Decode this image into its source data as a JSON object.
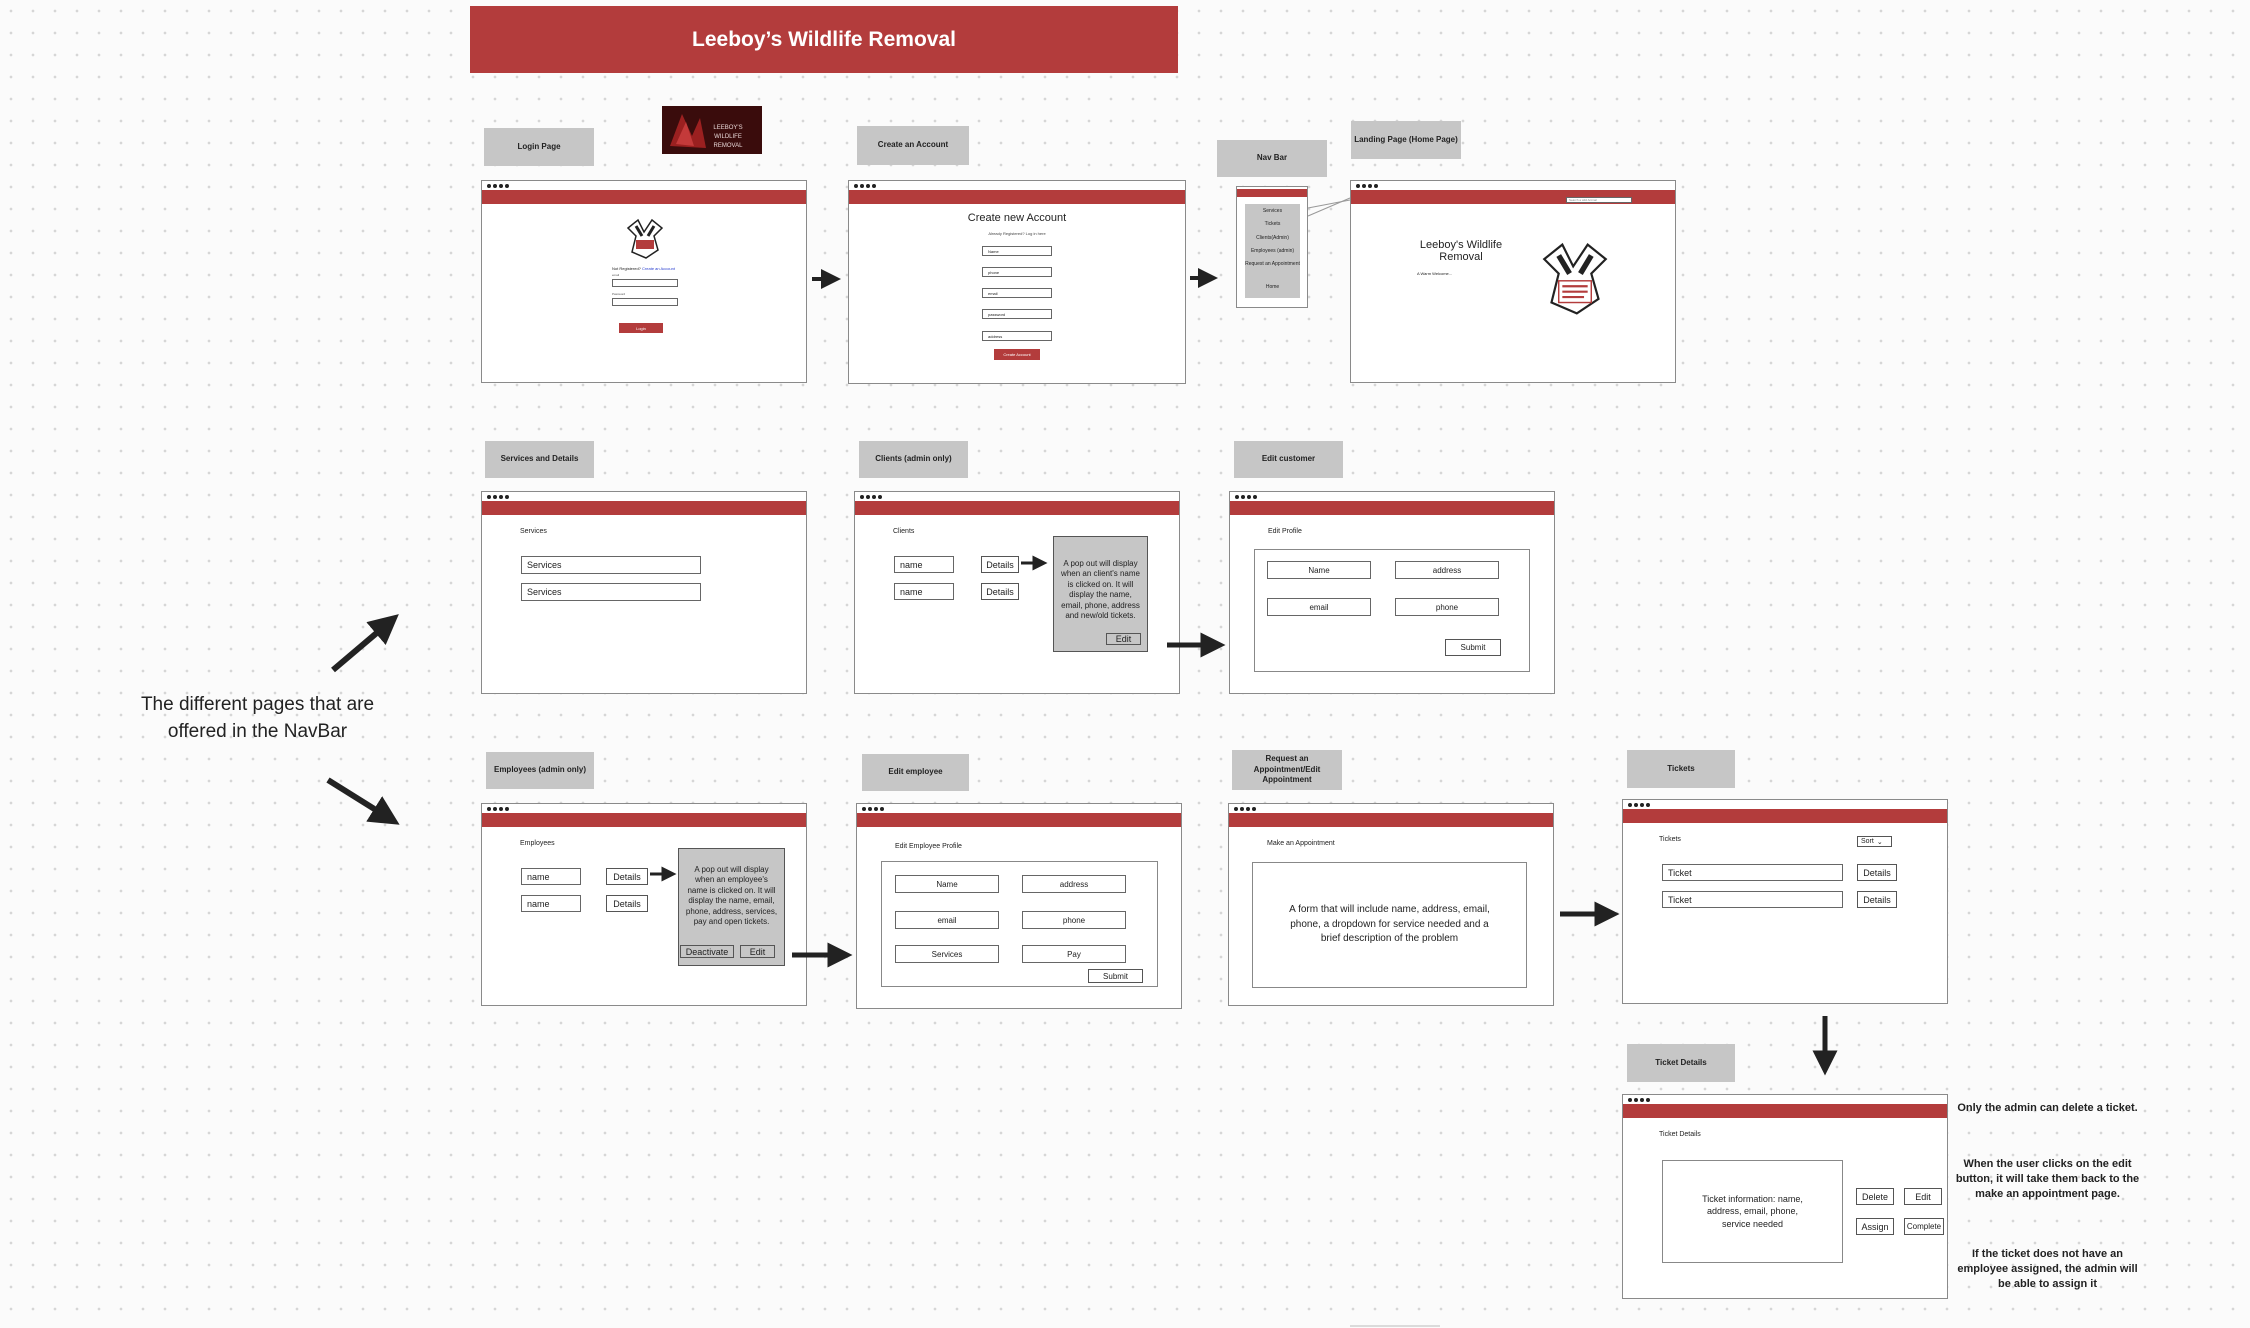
{
  "title": "Leeboy’s Wildlife Removal",
  "side_note": "The different pages that are offered in the NavBar",
  "logo_text": "LEEBOY'S WILDLIFE REMOVAL",
  "labels": {
    "login": "Login Page",
    "create": "Create an Account",
    "navbar": "Nav Bar",
    "landing": "Landing Page (Home Page)",
    "services": "Services and Details",
    "clients": "Clients (admin only)",
    "edit_customer": "Edit customer",
    "employees": "Employees (admin only)",
    "edit_employee": "Edit employee",
    "request": "Request an Appointment/Edit Appointment",
    "tickets": "Tickets",
    "ticket_details": "Ticket Details"
  },
  "login": {
    "not_registered": "Not Registered?",
    "create_link": "Create an Account",
    "email_label": "email",
    "password_label": "Password",
    "button": "Login"
  },
  "create": {
    "heading": "Create new Account",
    "subtext": "Already Registered? Log in here",
    "fields": [
      "Name",
      "phone",
      "email",
      "password",
      "address"
    ],
    "button": "Create Account"
  },
  "navbar": {
    "items": [
      "Services",
      "Tickets",
      "Clients(Admin)",
      "Employees (admin)",
      "Request an Appointment",
      "Home"
    ]
  },
  "landing": {
    "heading": "Leeboy's Wildlife Removal",
    "welcome": "A Warm Welcome...",
    "search_placeholder": "Search a wild Animal"
  },
  "services": {
    "heading": "Services",
    "items": [
      "Services",
      "Services"
    ]
  },
  "clients": {
    "heading": "Clients",
    "names": [
      "name",
      "name"
    ],
    "details": "Details",
    "popup": "A pop out will display when an client's name is clicked on. It will display the name, email, phone, address and new/old tickets.",
    "edit": "Edit"
  },
  "edit_customer": {
    "heading": "Edit Profile",
    "fields": [
      "Name",
      "address",
      "email",
      "phone"
    ],
    "submit": "Submit"
  },
  "employees": {
    "heading": "Employees",
    "names": [
      "name",
      "name"
    ],
    "details": "Details",
    "popup": "A pop out will display when an employee's name is clicked on. It will display the name, email, phone, address, services, pay and open tickets.",
    "deactivate": "Deactivate",
    "edit": "Edit"
  },
  "edit_employee": {
    "heading": "Edit Employee Profile",
    "fields": [
      "Name",
      "address",
      "email",
      "phone",
      "Services",
      "Pay"
    ],
    "submit": "Submit"
  },
  "request": {
    "heading": "Make an Appointment",
    "body": "A form that will include name, address, email, phone, a dropdown for service needed and a brief description of the problem"
  },
  "tickets": {
    "heading": "Tickets",
    "sort": "Sort",
    "items": [
      "Ticket",
      "Ticket"
    ],
    "details": "Details"
  },
  "ticket_details": {
    "heading": "Ticket Details",
    "info": "Ticket information: name, address, email, phone, service needed",
    "delete": "Delete",
    "edit": "Edit",
    "assign": "Assign",
    "complete": "Complete"
  },
  "notes": [
    "Only the admin can delete a ticket.",
    "When the user clicks on the edit button, it will take them back to the make an appointment page.",
    "If the ticket does not have an employee assigned, the admin will be able to assign it"
  ]
}
